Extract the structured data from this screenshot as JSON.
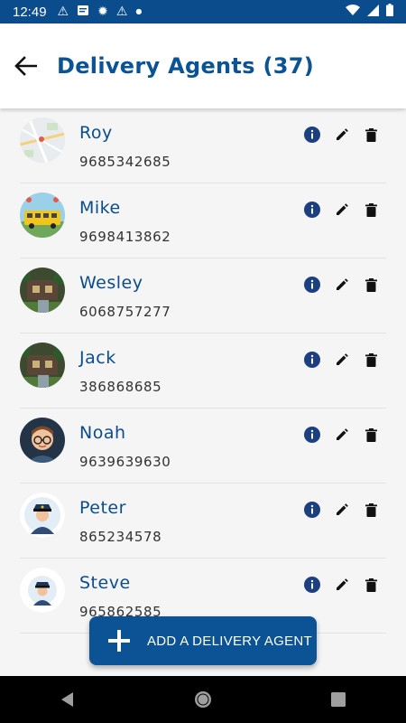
{
  "status_bar": {
    "time": "12:49",
    "icons": [
      "warning-icon",
      "message-icon",
      "settings-icon",
      "warning-icon",
      "dot-icon"
    ],
    "right_icons": [
      "wifi-icon",
      "signal-icon",
      "battery-icon"
    ]
  },
  "header": {
    "title": "Delivery Agents (37)"
  },
  "agents": [
    {
      "name": "Roy",
      "phone": "9685342685",
      "avatar": "map-avatar"
    },
    {
      "name": "Mike",
      "phone": "9698413862",
      "avatar": "school-bus-avatar"
    },
    {
      "name": "Wesley",
      "phone": "6068757277",
      "avatar": "house-avatar"
    },
    {
      "name": "Jack",
      "phone": "386868685",
      "avatar": "house-avatar"
    },
    {
      "name": "Noah",
      "phone": "9639639630",
      "avatar": "man-glasses-avatar"
    },
    {
      "name": "Peter",
      "phone": "865234578",
      "avatar": "police-avatar"
    },
    {
      "name": "Steve",
      "phone": "965862585",
      "avatar": "police-avatar"
    }
  ],
  "fab": {
    "label": "ADD A DELIVERY AGENT"
  },
  "colors": {
    "primary": "#0b5394",
    "status_bar": "#0b4d8c",
    "info_icon": "#1c3f80"
  }
}
